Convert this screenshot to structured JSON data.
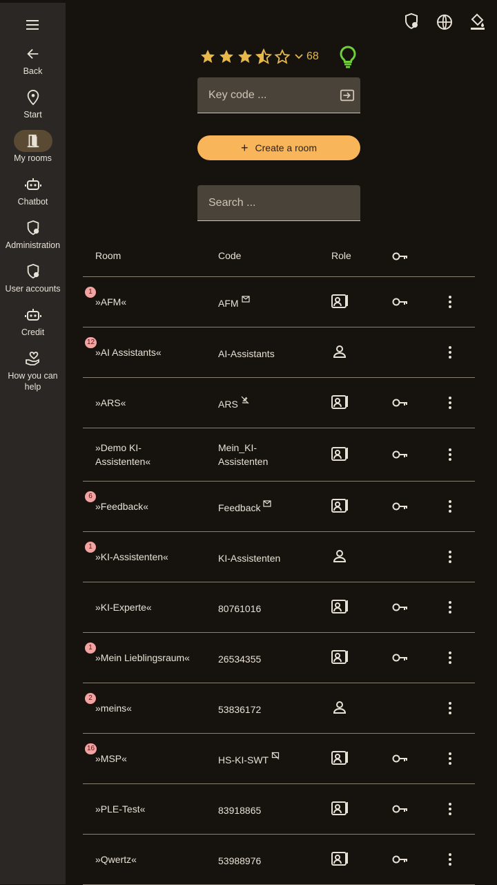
{
  "sidebar": {
    "items": [
      {
        "label": "Back",
        "icon": "arrow-left-icon"
      },
      {
        "label": "Start",
        "icon": "location-pin-icon"
      },
      {
        "label": "My rooms",
        "icon": "door-icon"
      },
      {
        "label": "Chatbot",
        "icon": "robot-icon"
      },
      {
        "label": "Administration",
        "icon": "admin-shield-icon"
      },
      {
        "label": "User accounts",
        "icon": "user-shield-icon"
      },
      {
        "label": "Credit",
        "icon": "robot-icon"
      },
      {
        "label": "How you can help",
        "icon": "hand-heart-icon"
      }
    ]
  },
  "rating": {
    "value": 3.5,
    "max": 5,
    "count": "68"
  },
  "key_input": {
    "placeholder": "Key code ..."
  },
  "create_button": {
    "label": "Create a room"
  },
  "search_input": {
    "placeholder": "Search ..."
  },
  "table": {
    "headers": {
      "room": "Room",
      "code": "Code",
      "role": "Role"
    },
    "rows": [
      {
        "badge": "1",
        "name": "»AFM«",
        "code": "AFM",
        "code_icon": "mail",
        "role": "moderator",
        "key": true
      },
      {
        "badge": "12",
        "name": "»AI Assistants«",
        "code": "AI-Assistants",
        "code_icon": "",
        "role": "participant",
        "key": false
      },
      {
        "badge": "",
        "name": "»ARS«",
        "code": "ARS",
        "code_icon": "mute",
        "role": "moderator",
        "key": true
      },
      {
        "badge": "",
        "name": "»Demo KI-Assistenten«",
        "code": "Mein_KI-Assistenten",
        "code_icon": "",
        "role": "moderator",
        "key": true
      },
      {
        "badge": "6",
        "name": "»Feedback«",
        "code": "Feedback",
        "code_icon": "mail",
        "role": "moderator",
        "key": true
      },
      {
        "badge": "1",
        "name": "»KI-Assistenten«",
        "code": "KI-Assistenten",
        "code_icon": "",
        "role": "participant",
        "key": false
      },
      {
        "badge": "",
        "name": "»KI-Experte«",
        "code": "80761016",
        "code_icon": "",
        "role": "moderator",
        "key": true
      },
      {
        "badge": "1",
        "name": "»Mein Lieblingsraum«",
        "code": "26534355",
        "code_icon": "",
        "role": "moderator",
        "key": true
      },
      {
        "badge": "2",
        "name": "»meins«",
        "code": "53836172",
        "code_icon": "",
        "role": "participant",
        "key": false
      },
      {
        "badge": "16",
        "name": "»MSP«",
        "code": "HS-KI-SWT",
        "code_icon": "no-chat",
        "role": "moderator",
        "key": true
      },
      {
        "badge": "",
        "name": "»PLE-Test«",
        "code": "83918865",
        "code_icon": "",
        "role": "moderator",
        "key": true
      },
      {
        "badge": "",
        "name": "»Qwertz«",
        "code": "53988976",
        "code_icon": "",
        "role": "moderator",
        "key": true
      }
    ]
  },
  "colors": {
    "accent": "#f8b55a",
    "star": "#e8b94a",
    "bulb": "#6ecf3a",
    "badge": "#f4a3a3"
  }
}
